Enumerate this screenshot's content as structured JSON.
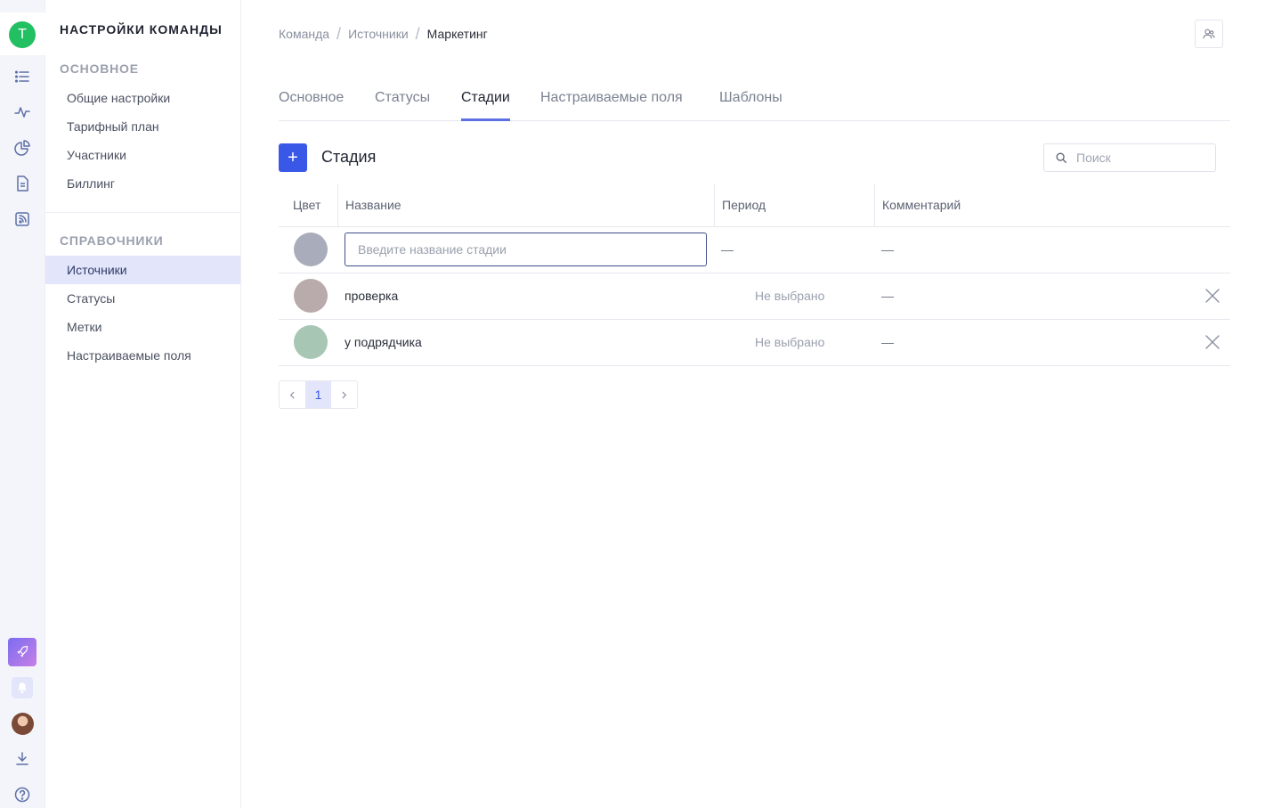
{
  "rail": {
    "team_initial": "T",
    "colors": {
      "team": "#22c063",
      "accent": "#3a58e8"
    }
  },
  "sidebar": {
    "title": "НАСТРОЙКИ КОМАНДЫ",
    "sections": [
      {
        "title": "ОСНОВНОЕ",
        "items": [
          "Общие настройки",
          "Тарифный план",
          "Участники",
          "Биллинг"
        ]
      },
      {
        "title": "СПРАВОЧНИКИ",
        "items": [
          "Источники",
          "Статусы",
          "Метки",
          "Настраиваемые поля"
        ]
      }
    ],
    "active_item": "Источники"
  },
  "breadcrumb": [
    "Команда",
    "Источники",
    "Маркетинг"
  ],
  "tabs": [
    "Основное",
    "Статусы",
    "Стадии",
    "Настраиваемые поля",
    "Шаблоны"
  ],
  "active_tab": "Стадии",
  "toolbar": {
    "add_label": "+",
    "title": "Стадия",
    "search_placeholder": "Поиск"
  },
  "table": {
    "columns": [
      "Цвет",
      "Название",
      "Период",
      "Комментарий"
    ],
    "new_row": {
      "placeholder": "Введите название стадии",
      "color": "#a9adbb",
      "period": "—",
      "comment": "—"
    },
    "rows": [
      {
        "color": "#b9aaab",
        "name": "проверка",
        "period": "Не выбрано",
        "comment": "—"
      },
      {
        "color": "#a7c6b4",
        "name": "у подрядчика",
        "period": "Не выбрано",
        "comment": "—"
      }
    ]
  },
  "pagination": {
    "current": "1"
  }
}
